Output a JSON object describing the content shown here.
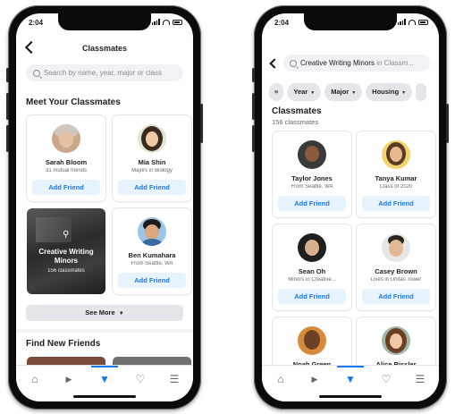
{
  "left_screen": {
    "status_time": "2:04",
    "header": {
      "title": "Classmates"
    },
    "search": {
      "placeholder": "Search by name, year, major or class"
    },
    "meet_section": "Meet Your Classmates",
    "cards": [
      {
        "name": "Sarah Bloom",
        "subtitle": "31 mutual friends",
        "action": "Add Friend"
      },
      {
        "name": "Mia Shin",
        "subtitle": "Majors in Biology",
        "action": "Add Friend"
      },
      {
        "name": "Ben Kumahara",
        "subtitle": "From Seattle, WA",
        "action": "Add Friend"
      }
    ],
    "group_card": {
      "name": "Creative Writing Minors",
      "subtitle": "156 classmates"
    },
    "see_more": "See More",
    "find_section": "Find New Friends"
  },
  "right_screen": {
    "status_time": "2:04",
    "search_query": "Creative Writing Minors",
    "search_suffix": "in Classm...",
    "filters": [
      "Year",
      "Major",
      "Housing"
    ],
    "heading": "Classmates",
    "count": "156 classmates",
    "cards": [
      {
        "name": "Taylor Jones",
        "subtitle": "From Seattle, WA",
        "action": "Add Friend"
      },
      {
        "name": "Tanya Kumar",
        "subtitle": "Class of 2020",
        "action": "Add Friend"
      },
      {
        "name": "Sean Oh",
        "subtitle": "Minors in Creative...",
        "action": "Add Friend"
      },
      {
        "name": "Casey Brown",
        "subtitle": "Lives in Unitas Tower",
        "action": "Add Friend"
      },
      {
        "name": "Noah Green",
        "subtitle": "",
        "action": ""
      },
      {
        "name": "Alice Rissler",
        "subtitle": "",
        "action": ""
      }
    ]
  },
  "tabbar": {
    "icons": [
      "home-icon",
      "watch-icon",
      "groups-icon",
      "notifications-icon",
      "menu-icon"
    ],
    "active": "groups-icon"
  },
  "colors": {
    "accent": "#1877f2",
    "button_bg": "#e7f3ff",
    "chip_bg": "#e4e6eb"
  }
}
